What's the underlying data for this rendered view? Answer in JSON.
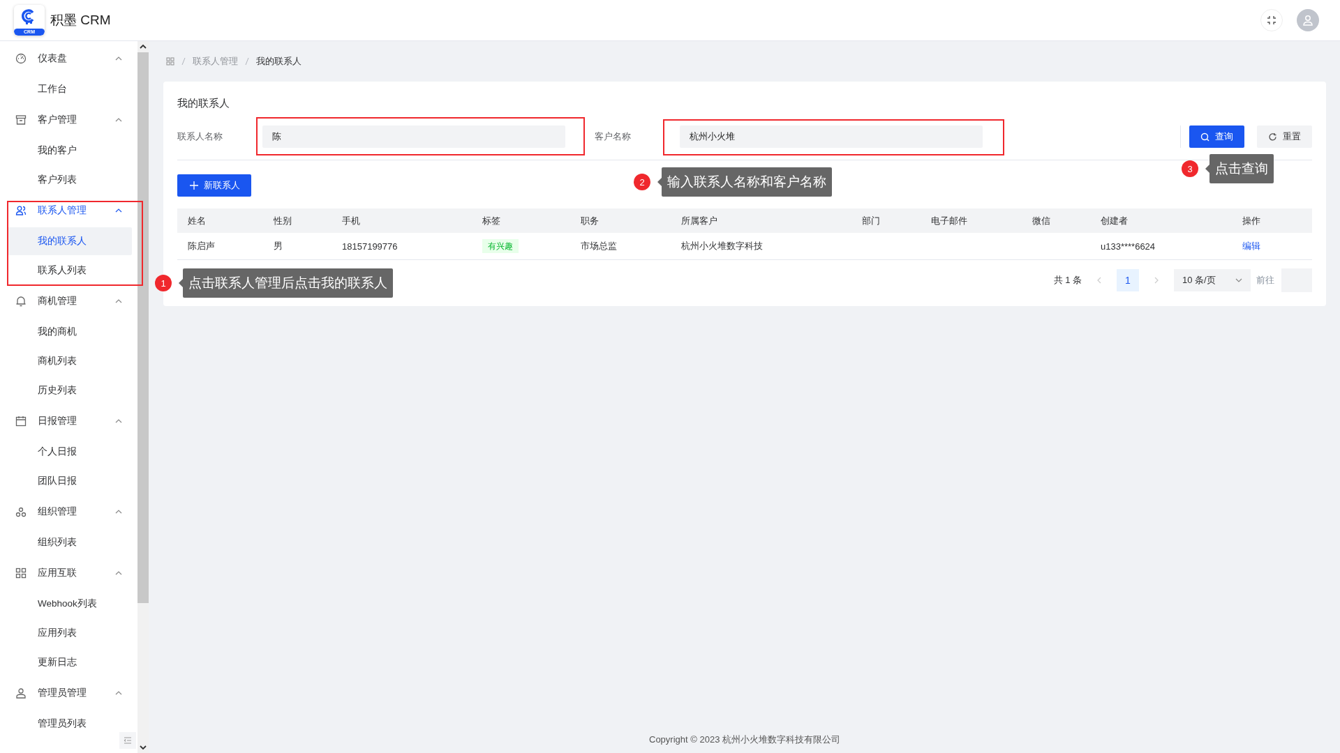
{
  "header": {
    "app_name": "积墨 CRM",
    "logo_text": "CRM"
  },
  "sidebar": {
    "items": [
      {
        "label": "仪表盘",
        "kind": "dashboard",
        "expanded": true,
        "active": false,
        "children": [
          {
            "label": "工作台",
            "selected": false
          }
        ]
      },
      {
        "label": "客户管理",
        "kind": "archive",
        "expanded": true,
        "active": false,
        "children": [
          {
            "label": "我的客户",
            "selected": false
          },
          {
            "label": "客户列表",
            "selected": false
          }
        ]
      },
      {
        "label": "联系人管理",
        "kind": "users",
        "expanded": true,
        "active": true,
        "children": [
          {
            "label": "我的联系人",
            "selected": true
          },
          {
            "label": "联系人列表",
            "selected": false
          }
        ]
      },
      {
        "label": "商机管理",
        "kind": "bell",
        "expanded": true,
        "active": false,
        "children": [
          {
            "label": "我的商机",
            "selected": false
          },
          {
            "label": "商机列表",
            "selected": false
          },
          {
            "label": "历史列表",
            "selected": false
          }
        ]
      },
      {
        "label": "日报管理",
        "kind": "calendar",
        "expanded": true,
        "active": false,
        "children": [
          {
            "label": "个人日报",
            "selected": false
          },
          {
            "label": "团队日报",
            "selected": false
          }
        ]
      },
      {
        "label": "组织管理",
        "kind": "org",
        "expanded": true,
        "active": false,
        "children": [
          {
            "label": "组织列表",
            "selected": false
          }
        ]
      },
      {
        "label": "应用互联",
        "kind": "grid",
        "expanded": true,
        "active": false,
        "children": [
          {
            "label": "Webhook列表",
            "selected": false
          },
          {
            "label": "应用列表",
            "selected": false
          },
          {
            "label": "更新日志",
            "selected": false
          }
        ]
      },
      {
        "label": "管理员管理",
        "kind": "user",
        "expanded": true,
        "active": false,
        "children": [
          {
            "label": "管理员列表",
            "selected": false
          }
        ]
      }
    ]
  },
  "breadcrumb": [
    "联系人管理",
    "我的联系人"
  ],
  "card": {
    "title": "我的联系人",
    "filters": [
      {
        "label": "联系人名称",
        "value": "陈"
      },
      {
        "label": "客户名称",
        "value": "杭州小火堆"
      }
    ],
    "query_button": "查询",
    "reset_button": "重置",
    "new_button": "新联系人",
    "table": {
      "columns": [
        "姓名",
        "性别",
        "手机",
        "标签",
        "职务",
        "所属客户",
        "部门",
        "电子邮件",
        "微信",
        "创建者",
        "操作"
      ],
      "rows": [
        {
          "name": "陈启声",
          "gender": "男",
          "phone": "18157199776",
          "tag": "有兴趣",
          "title": "市场总监",
          "customer": "杭州小火堆数字科技",
          "creator": "u133****6624",
          "action": "编辑"
        }
      ]
    },
    "pagination": {
      "total": "共 1 条",
      "pages": [
        {
          "label": "1",
          "selected": true
        }
      ],
      "page_size": "10 条/页",
      "goto": "前往"
    }
  },
  "footer": "Copyright © 2023 杭州小火堆数字科技有限公司",
  "annotations": [
    {
      "number": "1",
      "text": "点击联系人管理后点击我的联系人"
    },
    {
      "number": "2",
      "text": "输入联系人名称和客户名称"
    },
    {
      "number": "3",
      "text": "点击查询"
    }
  ]
}
